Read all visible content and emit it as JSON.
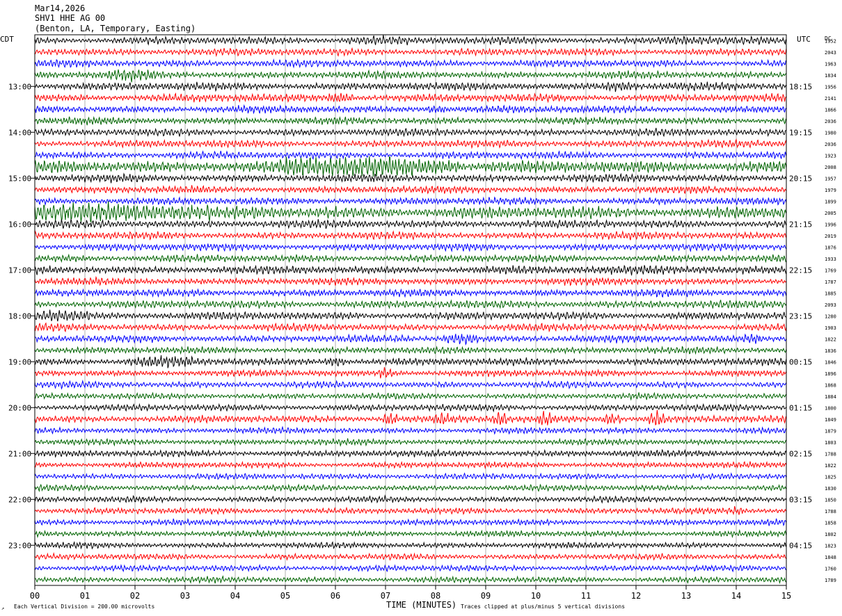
{
  "header": {
    "date": "Mar14,2026",
    "station": "SHV1 HHE AG 00",
    "location": "(Benton, LA, Temporary, Easting)"
  },
  "left_label": "CDT",
  "right_label": "UTC",
  "dc_label": "DC",
  "chart_data": {
    "type": "line",
    "title": "SHV1 HHE AG 00",
    "xlabel": "TIME (MINUTES)",
    "xlim": [
      0,
      15
    ],
    "x_ticks": [
      "00",
      "01",
      "02",
      "03",
      "04",
      "05",
      "06",
      "07",
      "08",
      "09",
      "10",
      "11",
      "12",
      "13",
      "14",
      "15"
    ],
    "trace_minutes": 15,
    "trace_colors": [
      "#000000",
      "#ff0000",
      "#0000ff",
      "#006400"
    ],
    "left_hour_labels": [
      "13:00",
      "14:00",
      "15:00",
      "16:00",
      "17:00",
      "18:00",
      "19:00",
      "20:00",
      "21:00",
      "22:00",
      "23:00"
    ],
    "left_hour_first_row": 4,
    "right_hour_labels": [
      "18:15",
      "19:15",
      "20:15",
      "21:15",
      "22:15",
      "23:15",
      "00:15",
      "01:15",
      "02:15",
      "03:15",
      "04:15"
    ],
    "dc_offsets": [
      "1952",
      "2043",
      "1963",
      "1834",
      "1956",
      "2141",
      "1866",
      "2036",
      "1980",
      "2036",
      "1923",
      "2008",
      "1957",
      "1979",
      "1899",
      "2005",
      "1996",
      "2019",
      "1876",
      "1933",
      "1769",
      "1787",
      "1885",
      "2093",
      "1280",
      "1903",
      "1822",
      "1836",
      "1846",
      "1896",
      "1868",
      "1884",
      "1800",
      "1849",
      "1879",
      "1803",
      "1788",
      "1822",
      "1825",
      "1830",
      "1850",
      "1788",
      "1858",
      "1802",
      "1823",
      "1848",
      "1760",
      "1789"
    ],
    "row_amplitude_pct": [
      55,
      55,
      55,
      55,
      60,
      60,
      55,
      55,
      55,
      55,
      55,
      90,
      60,
      55,
      55,
      90,
      60,
      55,
      55,
      55,
      60,
      55,
      55,
      60,
      60,
      55,
      55,
      50,
      55,
      50,
      50,
      45,
      50,
      55,
      45,
      45,
      50,
      45,
      45,
      45,
      45,
      45,
      45,
      45,
      45,
      45,
      45,
      45
    ],
    "events": [
      {
        "row": 0,
        "minute": 6.8,
        "duration": 1.2,
        "strength": 1.6
      },
      {
        "row": 0,
        "minute": 13.0,
        "duration": 1.0,
        "strength": 1.6
      },
      {
        "row": 3,
        "minute": 1.9,
        "duration": 0.8,
        "strength": 2.0
      },
      {
        "row": 4,
        "minute": 11.7,
        "duration": 0.6,
        "strength": 1.8
      },
      {
        "row": 5,
        "minute": 6.1,
        "duration": 0.4,
        "strength": 2.0
      },
      {
        "row": 6,
        "minute": 8.0,
        "duration": 0.3,
        "strength": 1.8
      },
      {
        "row": 11,
        "minute": 6.7,
        "duration": 3.5,
        "strength": 2.2
      },
      {
        "row": 15,
        "minute": 1.0,
        "duration": 5.0,
        "strength": 2.0
      },
      {
        "row": 20,
        "minute": 12.5,
        "duration": 2.0,
        "strength": 1.6
      },
      {
        "row": 24,
        "minute": 0.4,
        "duration": 1.4,
        "strength": 1.8
      },
      {
        "row": 26,
        "minute": 8.5,
        "duration": 0.6,
        "strength": 2.0
      },
      {
        "row": 26,
        "minute": 14.3,
        "duration": 0.3,
        "strength": 2.0
      },
      {
        "row": 28,
        "minute": 2.5,
        "duration": 1.2,
        "strength": 2.0
      },
      {
        "row": 28,
        "minute": 6.0,
        "duration": 0.3,
        "strength": 2.0
      },
      {
        "row": 29,
        "minute": 7.0,
        "duration": 0.2,
        "strength": 2.2
      },
      {
        "row": 33,
        "minute": 7.1,
        "duration": 0.2,
        "strength": 2.6
      },
      {
        "row": 33,
        "minute": 8.1,
        "duration": 0.2,
        "strength": 2.4
      },
      {
        "row": 33,
        "minute": 9.3,
        "duration": 0.2,
        "strength": 2.6
      },
      {
        "row": 33,
        "minute": 10.2,
        "duration": 0.2,
        "strength": 2.6
      },
      {
        "row": 33,
        "minute": 11.5,
        "duration": 0.3,
        "strength": 2.4
      },
      {
        "row": 33,
        "minute": 12.4,
        "duration": 0.3,
        "strength": 2.8
      },
      {
        "row": 41,
        "minute": 14.0,
        "duration": 0.2,
        "strength": 2.0
      }
    ]
  },
  "footer": {
    "scale_note": "Each Vertical Division =  200.00 microvolts",
    "clip_note": "Traces clipped at plus/minus 5 vertical divisions"
  }
}
